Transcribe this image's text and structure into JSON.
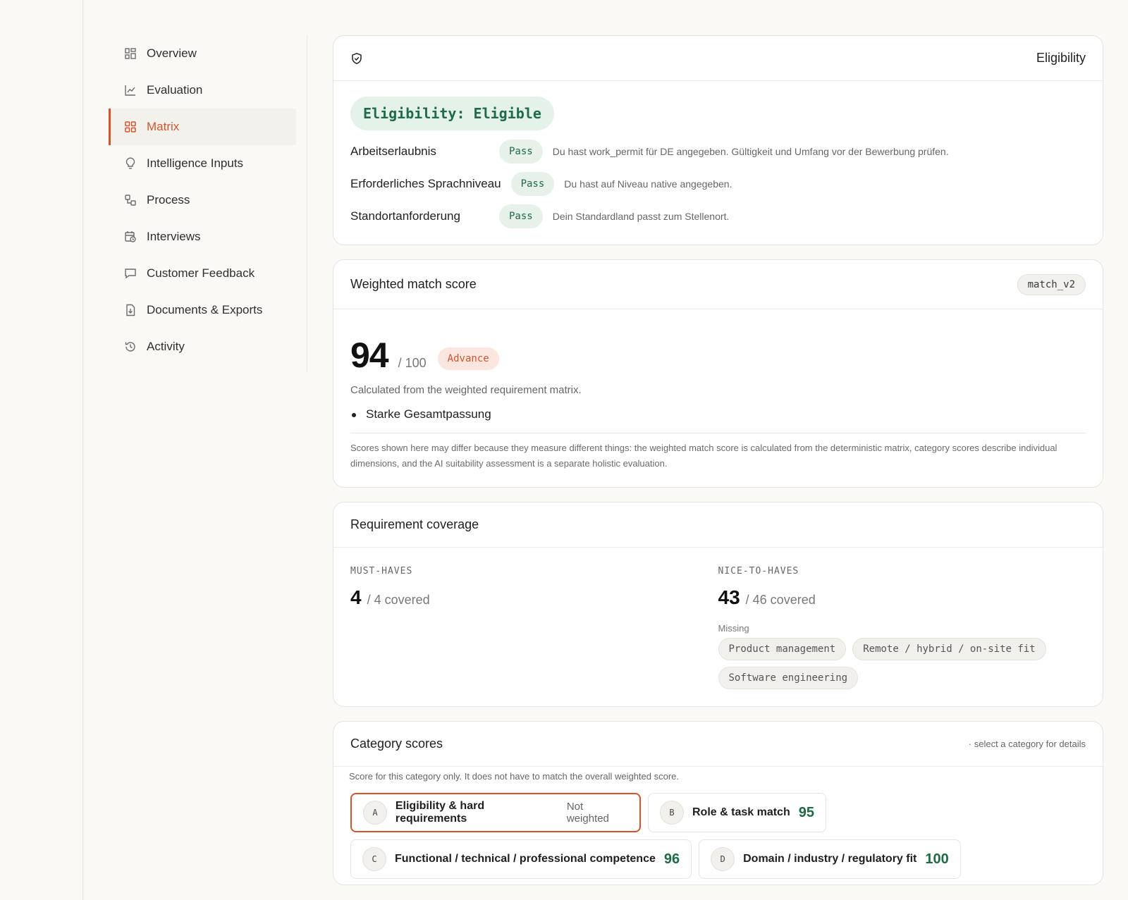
{
  "sidebar": {
    "items": [
      {
        "label": "Overview",
        "icon": "overview-grid-icon"
      },
      {
        "label": "Evaluation",
        "icon": "line-chart-icon"
      },
      {
        "label": "Matrix",
        "icon": "matrix-grid-icon",
        "active": true
      },
      {
        "label": "Intelligence Inputs",
        "icon": "lightbulb-icon"
      },
      {
        "label": "Process",
        "icon": "workflow-icon"
      },
      {
        "label": "Interviews",
        "icon": "calendar-clock-icon"
      },
      {
        "label": "Customer Feedback",
        "icon": "chat-bubble-icon"
      },
      {
        "label": "Documents & Exports",
        "icon": "file-download-icon"
      },
      {
        "label": "Activity",
        "icon": "history-icon"
      }
    ]
  },
  "eligibility": {
    "header_title": "Eligibility",
    "status": "Eligibility: Eligible",
    "rows": [
      {
        "name": "Arbeitserlaubnis",
        "result": "Pass",
        "note": "Du hast work_permit für DE angegeben. Gültigkeit und Umfang vor der Bewerbung prüfen."
      },
      {
        "name": "Erforderliches Sprachniveau",
        "result": "Pass",
        "note": "Du hast auf Niveau native angegeben."
      },
      {
        "name": "Standortanforderung",
        "result": "Pass",
        "note": "Dein Standardland passt zum Stellenort."
      }
    ]
  },
  "match": {
    "title": "Weighted match score",
    "version": "match_v2",
    "score": "94",
    "out_of": "/ 100",
    "verdict": "Advance",
    "calc_note": "Calculated from the weighted requirement matrix.",
    "bullets": [
      "Starke Gesamtpassung"
    ],
    "disclaimer": "Scores shown here may differ because they measure different things: the weighted match score is calculated from the deterministic matrix, category scores describe individual dimensions, and the AI suitability assessment is a separate holistic evaluation."
  },
  "coverage": {
    "title": "Requirement coverage",
    "must": {
      "label": "MUST-HAVES",
      "covered": "4",
      "total_text": "/ 4 covered"
    },
    "nice": {
      "label": "NICE-TO-HAVES",
      "covered": "43",
      "total_text": "/ 46 covered",
      "missing_label": "Missing",
      "missing": [
        "Product management",
        "Remote / hybrid / on-site fit",
        "Software engineering"
      ]
    }
  },
  "categories": {
    "title": "Category scores",
    "hint": "· select a category for details",
    "note": "Score for this category only. It does not have to match the overall weighted score.",
    "items": [
      {
        "letter": "A",
        "name": "Eligibility & hard requirements",
        "extra": "Not weighted",
        "selected": true
      },
      {
        "letter": "B",
        "name": "Role & task match",
        "score": "95"
      },
      {
        "letter": "C",
        "name": "Functional / technical / professional competence",
        "score": "96"
      },
      {
        "letter": "D",
        "name": "Domain / industry / regulatory fit",
        "score": "100"
      }
    ]
  },
  "colors": {
    "accent": "#d4532e",
    "success": "#1e6b46",
    "success_bg": "#e4f2ea",
    "background": "#faf9f6"
  }
}
